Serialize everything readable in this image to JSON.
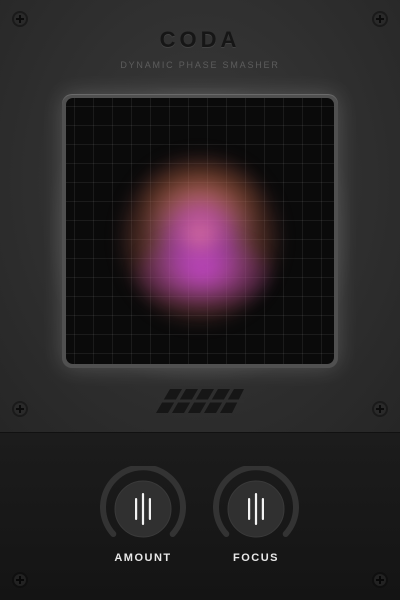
{
  "app": {
    "title": "CODA",
    "subtitle": "DYNAMIC PHASE SMASHER"
  },
  "display": {
    "blob_colors": [
      "#eb78aa",
      "#cd55be",
      "#f08c50"
    ]
  },
  "knobs": [
    {
      "label": "AMOUNT",
      "icon": "knob-grip-icon"
    },
    {
      "label": "FOCUS",
      "icon": "knob-grip-icon"
    }
  ],
  "colors": {
    "panel": "#2e2e2e",
    "bottom_panel": "#171717",
    "label": "#e8e8e8"
  }
}
